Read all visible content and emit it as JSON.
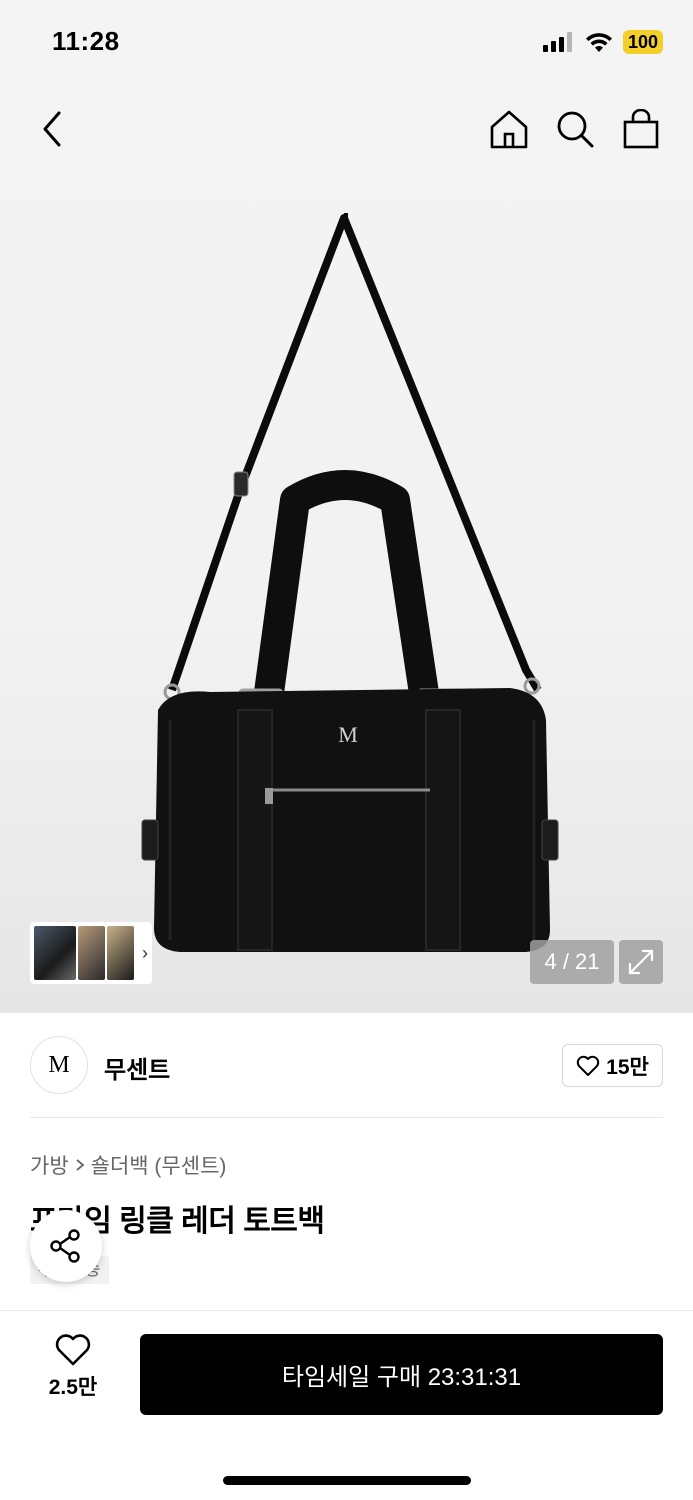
{
  "status": {
    "time": "11:28",
    "battery": "100"
  },
  "nav": {
    "back_icon": "chevron-left-icon",
    "icons": [
      "home-icon",
      "search-icon",
      "shopping-bag-icon"
    ]
  },
  "gallery": {
    "logo_on_bag": "M",
    "counter": "4 / 21",
    "thumb_arrow": "›"
  },
  "brand": {
    "logo_text": "M",
    "name": "무센트",
    "likes": "15만"
  },
  "product": {
    "breadcrumb": [
      "가방",
      "숄더백 (무센트)"
    ],
    "title": "프라임 링클 레더 토트백",
    "tag": "무료배송"
  },
  "bottom": {
    "wish_count": "2.5만",
    "buy_label": "타임세일 구매 23:31:31"
  },
  "colors": {
    "accent": "#000000",
    "battery": "#f2cf2b"
  }
}
